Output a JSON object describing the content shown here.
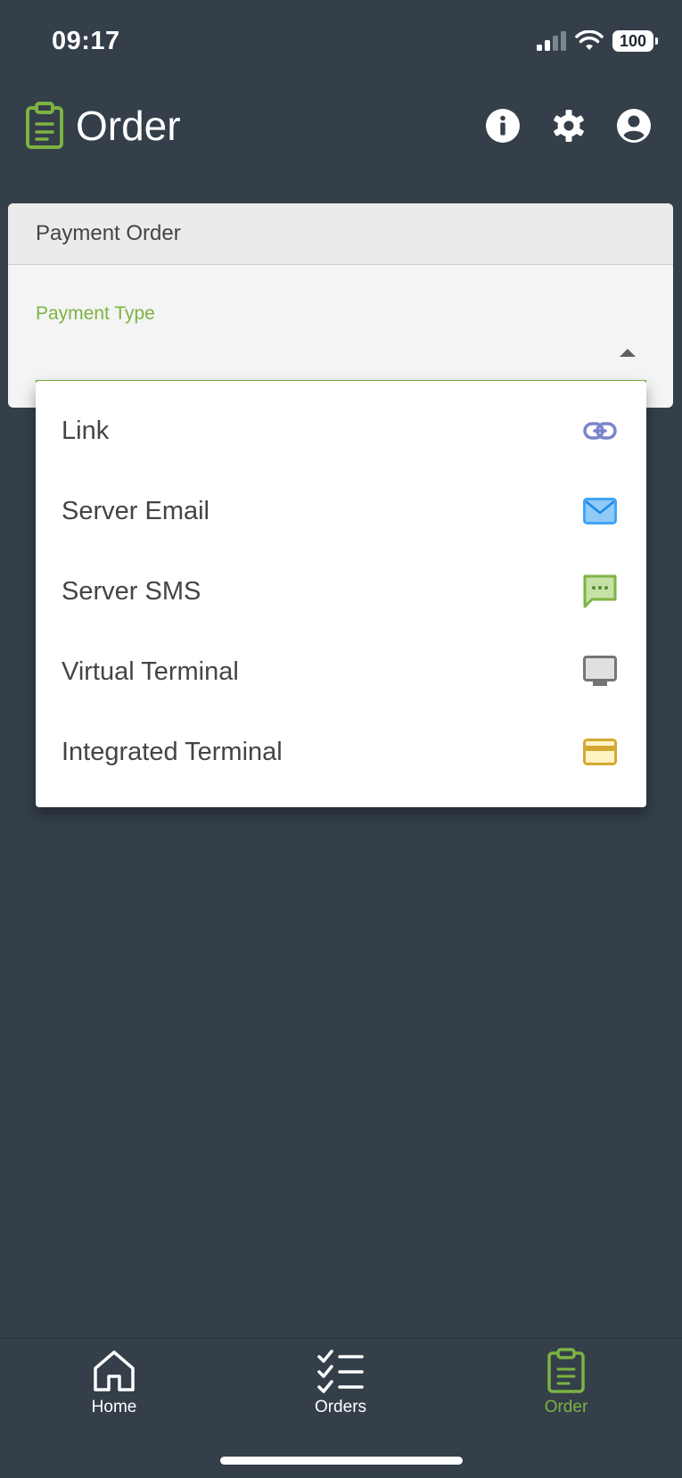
{
  "status_bar": {
    "time": "09:17",
    "battery": "100"
  },
  "header": {
    "title": "Order",
    "logo_icon": "clipboard-icon",
    "actions": [
      "info-icon",
      "gear-icon",
      "account-icon"
    ]
  },
  "card": {
    "title": "Payment Order",
    "field_label": "Payment Type",
    "field_value": ""
  },
  "dropdown": {
    "options": [
      {
        "label": "Link",
        "icon": "link-icon",
        "color": "#7986cb"
      },
      {
        "label": "Server Email",
        "icon": "email-icon",
        "color": "#42a5f5"
      },
      {
        "label": "Server SMS",
        "icon": "sms-icon",
        "color": "#7cb342"
      },
      {
        "label": "Virtual Terminal",
        "icon": "monitor-icon",
        "color": "#757575"
      },
      {
        "label": "Integrated Terminal",
        "icon": "card-icon",
        "color": "#d4a933"
      }
    ]
  },
  "bottom_nav": {
    "items": [
      {
        "label": "Home",
        "icon": "home-icon"
      },
      {
        "label": "Orders",
        "icon": "checklist-icon"
      },
      {
        "label": "Order",
        "icon": "clipboard-icon",
        "active": true
      }
    ]
  },
  "colors": {
    "background": "#343f4a",
    "accent": "#7cb342",
    "card": "#f4f4f4"
  }
}
